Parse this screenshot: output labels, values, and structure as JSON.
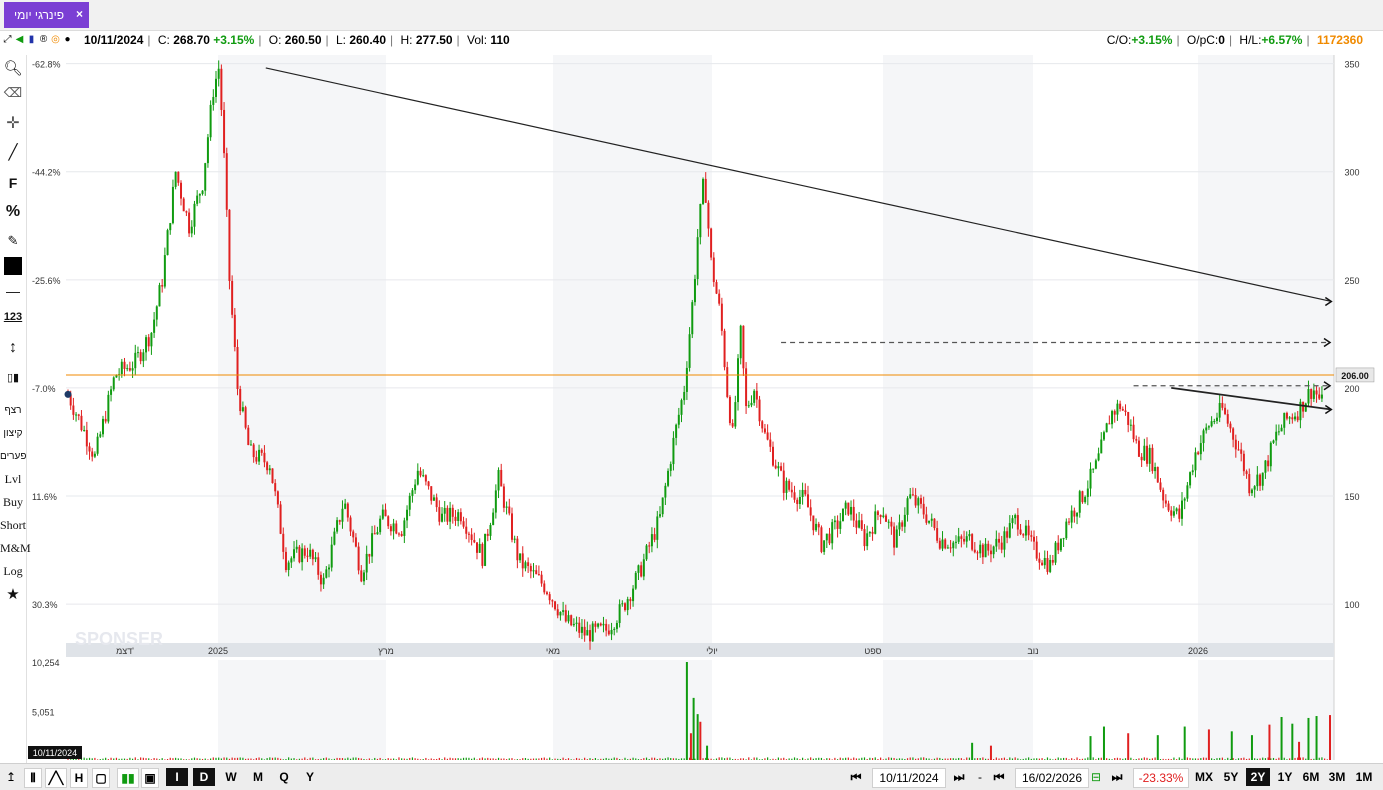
{
  "tab": {
    "label": "פינרגי יומי",
    "close": "×"
  },
  "info": {
    "date": "10/11/2024",
    "c_label": "C:",
    "c_val": "268.70",
    "c_pct": "+3.15%",
    "o_label": "O:",
    "o_val": "260.50",
    "l_label": "L:",
    "l_val": "260.40",
    "h_label": "H:",
    "h_val": "277.50",
    "vol_label": "Vol:",
    "vol_val": "110",
    "co_label": "C/O:",
    "co_val": "+3.15%",
    "opc_label": "O/pC:",
    "opc_val": "0",
    "hl_label": "H/L:",
    "hl_val": "+6.57%",
    "id": "1172360"
  },
  "left_toolbar": {
    "f": "F",
    "pct": "%",
    "num": "123",
    "items": [
      "רצף",
      "קיצון",
      "פערים",
      "Lvl",
      "Buy",
      "Short",
      "M&M",
      "Log"
    ]
  },
  "colors": {
    "up": "#109b10",
    "down": "#e02020",
    "hline": "#f08a00",
    "tab": "#7b3fd4"
  },
  "chart_data": {
    "type": "candlestick",
    "y_ticks_right": [
      100,
      150,
      200,
      250,
      300,
      350
    ],
    "y_ticks_left": [
      "30.3%",
      "11.6%",
      "-7.0%",
      "-25.6%",
      "-44.2%",
      "-62.8%"
    ],
    "ylim": [
      82,
      354
    ],
    "x_labels": [
      "דצמ'",
      "2025",
      "מרץ",
      "מאי",
      "יולי",
      "ספט",
      "נוב",
      "2026"
    ],
    "price_tag": "206.00",
    "horizontal_line": 206,
    "keypoints": [
      [
        0,
        197
      ],
      [
        12,
        180
      ],
      [
        20,
        168
      ],
      [
        35,
        206
      ],
      [
        50,
        212
      ],
      [
        62,
        226
      ],
      [
        70,
        250
      ],
      [
        80,
        300
      ],
      [
        90,
        275
      ],
      [
        100,
        295
      ],
      [
        108,
        338
      ],
      [
        112,
        348
      ],
      [
        115,
        320
      ],
      [
        120,
        250
      ],
      [
        126,
        200
      ],
      [
        135,
        170
      ],
      [
        150,
        165
      ],
      [
        162,
        120
      ],
      [
        178,
        125
      ],
      [
        190,
        110
      ],
      [
        205,
        148
      ],
      [
        218,
        115
      ],
      [
        233,
        140
      ],
      [
        248,
        135
      ],
      [
        260,
        162
      ],
      [
        278,
        140
      ],
      [
        292,
        142
      ],
      [
        308,
        122
      ],
      [
        320,
        158
      ],
      [
        335,
        120
      ],
      [
        355,
        108
      ],
      [
        370,
        92
      ],
      [
        385,
        86
      ],
      [
        400,
        88
      ],
      [
        412,
        98
      ],
      [
        425,
        115
      ],
      [
        440,
        140
      ],
      [
        450,
        175
      ],
      [
        458,
        200
      ],
      [
        465,
        245
      ],
      [
        468,
        270
      ],
      [
        473,
        298
      ],
      [
        478,
        258
      ],
      [
        485,
        233
      ],
      [
        490,
        198
      ],
      [
        494,
        178
      ],
      [
        500,
        225
      ],
      [
        504,
        190
      ],
      [
        510,
        200
      ],
      [
        518,
        178
      ],
      [
        523,
        170
      ],
      [
        532,
        155
      ],
      [
        548,
        148
      ],
      [
        560,
        128
      ],
      [
        570,
        135
      ],
      [
        580,
        145
      ],
      [
        592,
        130
      ],
      [
        605,
        145
      ],
      [
        615,
        128
      ],
      [
        625,
        150
      ],
      [
        637,
        142
      ],
      [
        648,
        130
      ],
      [
        660,
        128
      ],
      [
        670,
        130
      ],
      [
        682,
        124
      ],
      [
        695,
        130
      ],
      [
        705,
        140
      ],
      [
        718,
        125
      ],
      [
        730,
        118
      ],
      [
        742,
        138
      ],
      [
        754,
        150
      ],
      [
        765,
        165
      ],
      [
        775,
        188
      ],
      [
        782,
        192
      ],
      [
        788,
        185
      ],
      [
        795,
        172
      ],
      [
        805,
        168
      ],
      [
        815,
        148
      ],
      [
        826,
        140
      ],
      [
        838,
        170
      ],
      [
        848,
        183
      ],
      [
        858,
        190
      ],
      [
        870,
        172
      ],
      [
        878,
        155
      ],
      [
        888,
        160
      ],
      [
        898,
        178
      ],
      [
        905,
        185
      ],
      [
        915,
        190
      ],
      [
        925,
        200
      ],
      [
        933,
        192
      ]
    ],
    "candle_count": 939,
    "volume_labels": [
      "10,254",
      "5,051"
    ],
    "volume_spikes": [
      [
        460,
        10254
      ],
      [
        463,
        2800
      ],
      [
        465,
        6500
      ],
      [
        468,
        4800
      ],
      [
        470,
        4000
      ],
      [
        475,
        1500
      ],
      [
        672,
        1800
      ],
      [
        686,
        1500
      ],
      [
        760,
        2500
      ],
      [
        770,
        3500
      ],
      [
        788,
        2800
      ],
      [
        810,
        2600
      ],
      [
        830,
        3500
      ],
      [
        848,
        3200
      ],
      [
        865,
        3000
      ],
      [
        880,
        2600
      ],
      [
        893,
        3700
      ],
      [
        902,
        4500
      ],
      [
        910,
        3800
      ],
      [
        915,
        1900
      ],
      [
        922,
        4400
      ],
      [
        928,
        4600
      ],
      [
        938,
        4700
      ]
    ],
    "trendlines": [
      {
        "from": [
          147,
          348
        ],
        "to": [
          939,
          240
        ],
        "arrow": true
      },
      {
        "from": [
          820,
          200
        ],
        "to": [
          939,
          190
        ],
        "arrow": true
      }
    ],
    "dashed_levels": [
      {
        "from_index": 530,
        "value": 221
      },
      {
        "from_index": 792,
        "value": 201
      }
    ],
    "date_box": "10/11/2024"
  },
  "bottom": {
    "chart_types": [
      "I",
      "D",
      "W",
      "M",
      "Q",
      "Y"
    ],
    "date_from": "10/11/2024",
    "dash": "-",
    "date_to": "16/02/2026",
    "change": "-23.33%",
    "ranges": [
      "MX",
      "5Y",
      "2Y",
      "1Y",
      "6M",
      "3M",
      "1M"
    ],
    "nav_first": "⏮",
    "nav_last": "⏭"
  }
}
